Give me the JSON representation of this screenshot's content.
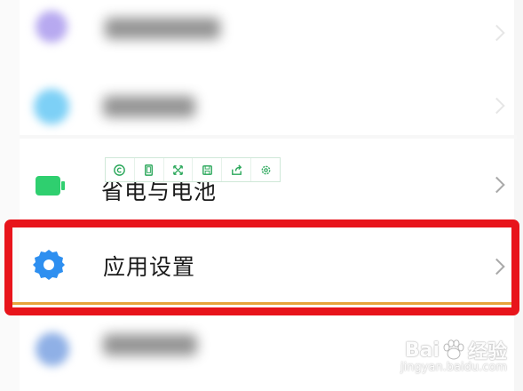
{
  "rows": {
    "battery_label": "省电与电池",
    "app_settings_label": "应用设置"
  },
  "toolbar": {
    "tools": [
      "copyright-icon",
      "phone-frame-icon",
      "expand-icon",
      "save-icon",
      "share-icon",
      "settings-icon"
    ]
  },
  "watermark": {
    "brand_prefix": "Bai",
    "brand_suffix": "经验",
    "sub": "jingyan.baidu.com"
  },
  "colors": {
    "accent_blue": "#2e8ff0",
    "battery_green": "#2fcf6f",
    "highlight_red": "#e8141b",
    "toolbar_green": "#2aa75a"
  }
}
